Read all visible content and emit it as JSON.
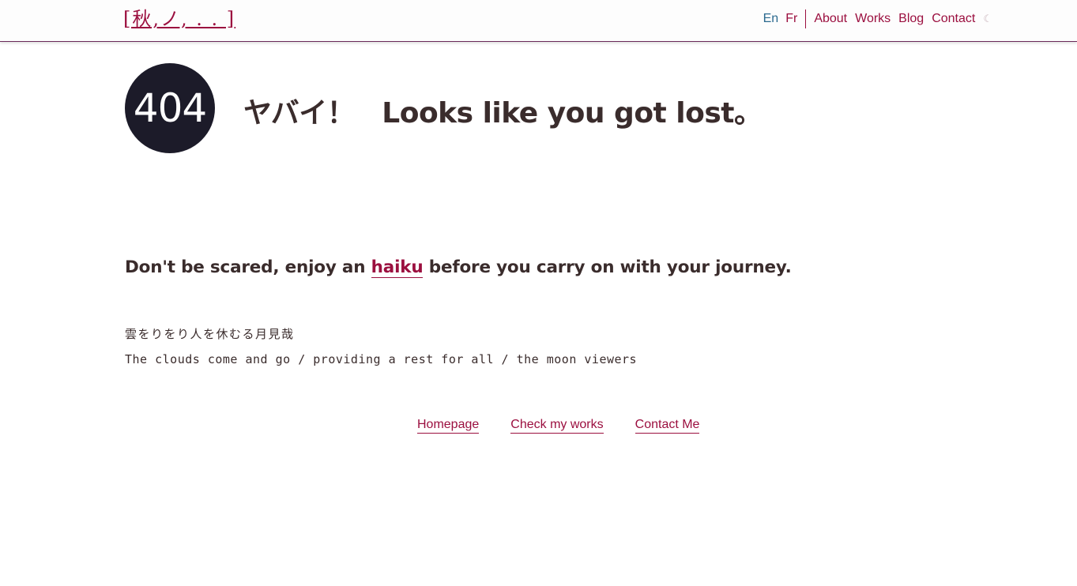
{
  "header": {
    "logo_text": "[秋,ノ, . . ]",
    "lang": [
      {
        "label": "En",
        "active": true
      },
      {
        "label": "Fr",
        "active": false
      }
    ],
    "nav": [
      {
        "label": "About"
      },
      {
        "label": "Works"
      },
      {
        "label": "Blog"
      },
      {
        "label": "Contact"
      }
    ],
    "theme_icon": "moon-icon",
    "theme_glyph": "☾"
  },
  "error": {
    "code": "404",
    "title_jp": "ヤバイ！",
    "title_en": "Looks like you got lost。"
  },
  "haiku": {
    "intro_before": "Don't be scared, enjoy an",
    "intro_link": "haiku",
    "intro_after": "before you carry on with your journey.",
    "japanese": "雲をりをり人を休むる月見哉",
    "english": "The clouds come and go / providing a rest for all / the moon viewers"
  },
  "links": [
    {
      "label": "Homepage"
    },
    {
      "label": "Check my works"
    },
    {
      "label": "Contact Me"
    }
  ],
  "colors": {
    "accent": "#9b0f3f",
    "active_lang": "#2b6a8f",
    "text": "#3a2c2c",
    "circle": "#1c1b29"
  }
}
